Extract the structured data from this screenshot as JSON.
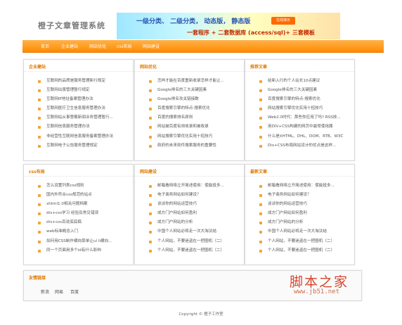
{
  "site_title": "橙子文章管理系统",
  "banner": {
    "line1": "一级分类、 二级分类， 动态版， 静态版",
    "badge": "在线演示",
    "line2": "一套程序 + 二套数据库 (access/sql)+ 三套模板"
  },
  "nav": [
    "首页",
    "企业建站",
    "网站优化",
    "css布局",
    "网站建设"
  ],
  "boxes": [
    {
      "title": "企业建站",
      "items": [
        "互联网的品质是服务管理新行规定",
        "互联网出版管理暂行规定",
        "互联网IP地址备案管理办法",
        "互联网医疗卫生信息服务管理办法",
        "互联网站从事登载新闻业务管理暂行...",
        "互联网信息服务管理办法",
        "非经营性互联网信息服务备案管理办法",
        "互联网电子公告服务管理规定"
      ]
    },
    {
      "title": "网站优化",
      "items": [
        "怎样才能在百度重新收录怎样才能让...",
        "Google排名的三大关键因素",
        "Google排名攻关链接数",
        "百度搜索引擎的特点-搜索优化",
        "百度的搜索排名原则",
        "网站被百度有效收录和被收录",
        "网站搜索引擎优化实用十招技巧",
        "政府的未来软件搜索服务的重要性"
      ]
    },
    {
      "title": "推荐文章",
      "items": [
        "给新入行的个人站长10点建议",
        "Google排名的三大关键因素",
        "百度搜索引擎的特点-搜索优化",
        "网站搜索引擎优化实用十招技巧",
        "Web2.0时代：那些你应用了吗? RSS技...",
        "用DIV+CSS构建的网页中最常使用属",
        "什么是XHTML、DHL、DOM、RTB、W3C",
        "Div+CSS布局网站设计的优点是这样..."
      ]
    },
    {
      "title": "css布局",
      "items": [
        "怎么设置列表css规则",
        "国内外符合css规范的站点",
        "xhtml1.0相关问题档案",
        "div+css学习  经验及常见错误",
        "div+css百说底底稿",
        "web标准概念入门",
        "如何用CSS制作横向菜单让ul li横向...",
        "同一个页面用多个id有什么影响"
      ]
    },
    {
      "title": "网站建设",
      "items": [
        "邮箱看网络立开简述使用：使能投多...",
        "电子商务网站如何建设？",
        "谈谈你的网站运营技巧",
        "成方门户网站如何盈利",
        "成方门户网站的分析",
        "中国个人网站必将走一次大淘汰结",
        "个人网站，不要迷盗在一把圈机（二）",
        "个人网站，不要迷盗在一把圈机（二）"
      ]
    },
    {
      "title": "最新文章",
      "items": [
        "邮箱看网络立开简述使用：使能投多...",
        "电子商务网站如何建设？",
        "谈谈你的网站运营技巧",
        "成方门户网站如何盈利",
        "成方门户网站的分析",
        "中国个人网站必将走一次大淘汰结",
        "个人网站，不要迷盗在一把圈机（二）",
        "个人网站，不要迷盗在一把圈机（二）"
      ]
    }
  ],
  "links_box": {
    "title": "友情链接",
    "items": [
      "新浪",
      "网易",
      "百度"
    ]
  },
  "footer": "Copyright © 橙子工作室",
  "watermark": {
    "text": "脚本之家",
    "url": "www.jb51.net"
  }
}
